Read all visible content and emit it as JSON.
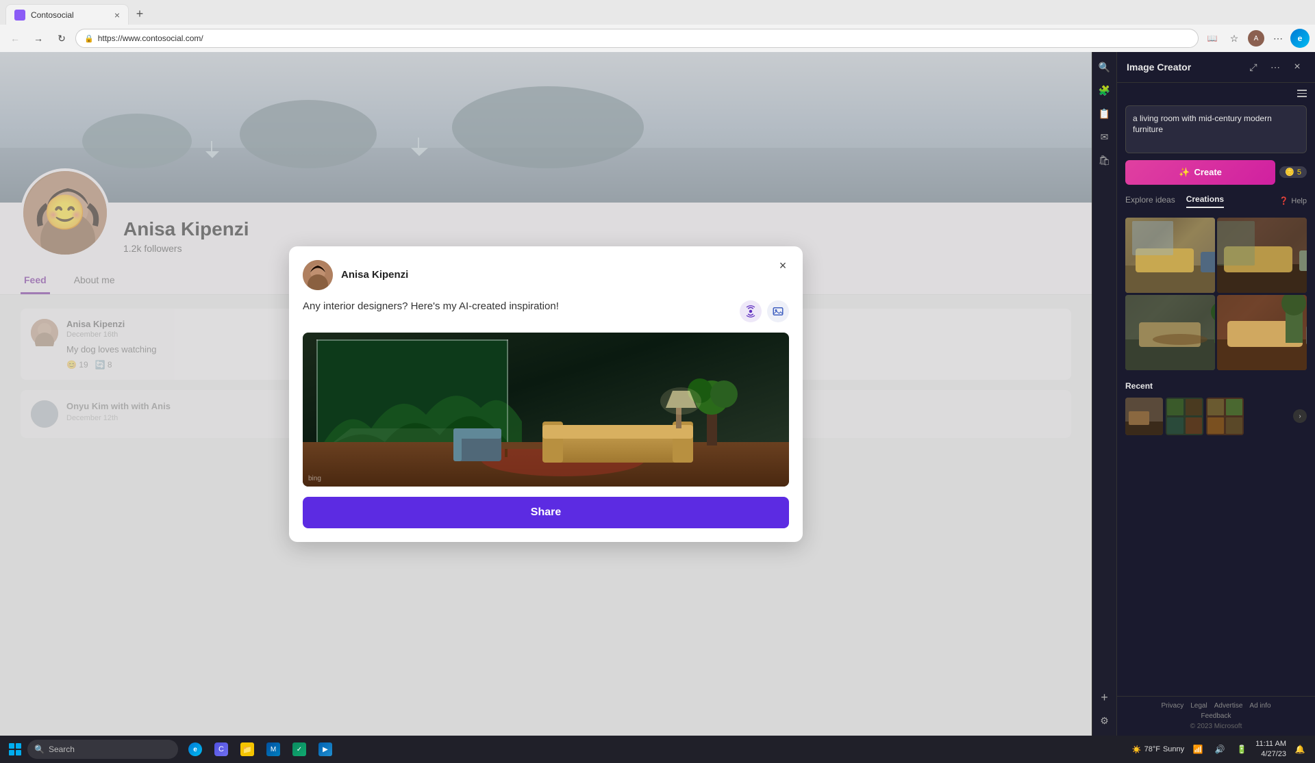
{
  "browser": {
    "tab_label": "Contosocial",
    "url": "https://www.contosocial.com/",
    "favicon_color": "#8b5cf6"
  },
  "social": {
    "profile_name": "Anisa Kipenzi",
    "followers": "1.2k followers",
    "nav_tabs": [
      "Feed",
      "About me"
    ],
    "active_tab": "Feed",
    "posts": [
      {
        "author": "Anisa Kipenzi",
        "date": "December 16th",
        "text": "My dog loves watching",
        "reactions": [
          {
            "icon": "😊",
            "count": "19"
          },
          {
            "icon": "🔄",
            "count": "8"
          }
        ]
      },
      {
        "author": "Onyu Kim",
        "coauthor": "with Anis",
        "date": "December 12th"
      }
    ]
  },
  "modal": {
    "user_name": "Anisa Kipenzi",
    "post_text": "Any interior designers? Here's my AI-created inspiration!",
    "share_label": "Share",
    "close_label": "×"
  },
  "image_creator": {
    "panel_title": "Image Creator",
    "prompt_text": "a living room with mid-century modern furniture",
    "create_button_label": "Create",
    "boost_count": "5",
    "tabs": [
      "Explore ideas",
      "Creations"
    ],
    "active_tab": "Creations",
    "help_label": "Help",
    "section_recent": "Recent",
    "footer": {
      "privacy": "Privacy",
      "legal": "Legal",
      "advertise": "Advertise",
      "ad_info": "Ad info",
      "feedback": "Feedback",
      "copyright": "© 2023 Microsoft"
    }
  },
  "taskbar": {
    "search_placeholder": "Search",
    "time": "11:11 AM",
    "date": "4/27/23",
    "weather": "78°F",
    "weather_condition": "Sunny"
  }
}
